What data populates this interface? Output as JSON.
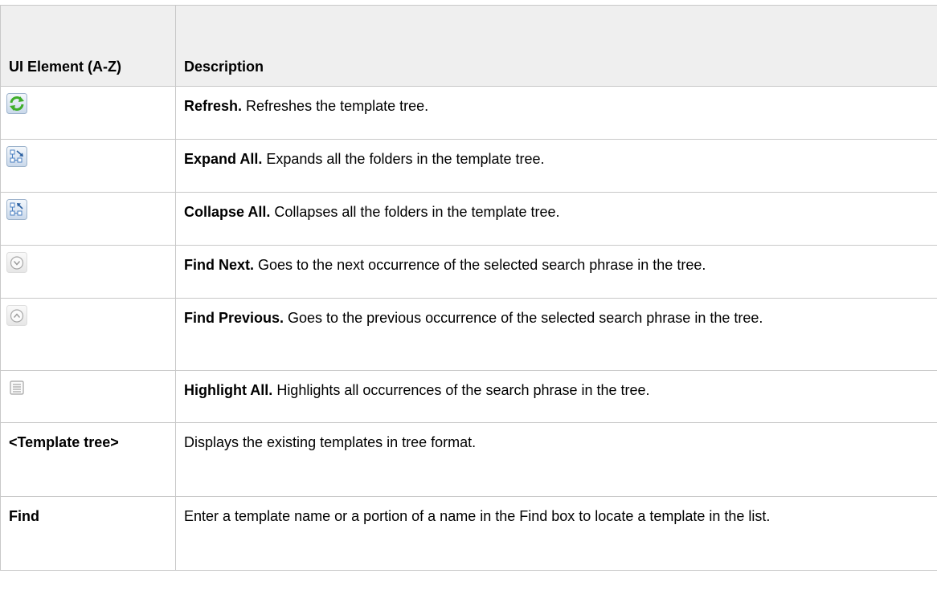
{
  "table": {
    "headers": {
      "element": "UI Element (A-Z)",
      "description": "Description"
    },
    "rows": [
      {
        "icon": "refresh-icon",
        "term": "Refresh.",
        "desc": " Refreshes the template tree."
      },
      {
        "icon": "expand-all-icon",
        "term": "Expand All.",
        "desc": " Expands all the folders in the template tree."
      },
      {
        "icon": "collapse-all-icon",
        "term": "Collapse All.",
        "desc": " Collapses all the folders in the template tree."
      },
      {
        "icon": "find-next-icon",
        "term": "Find Next.",
        "desc": " Goes to the next occurrence of the selected search phrase in the tree."
      },
      {
        "icon": "find-previous-icon",
        "term": "Find Previous.",
        "desc": " Goes to the previous occurrence of the selected search phrase in the tree."
      },
      {
        "icon": "highlight-all-icon",
        "term": "Highlight All.",
        "desc": " Highlights all occurrences of the search phrase in the tree."
      },
      {
        "name": "<Template tree>",
        "desc": "Displays the existing templates in tree format."
      },
      {
        "name": "Find",
        "desc": "Enter a template name or a portion of a name in the Find box to locate a template in the list."
      }
    ]
  },
  "colors": {
    "header_bg": "#efefef",
    "border": "#c8c8c8",
    "refresh_green": "#3fae2a",
    "icon_blue": "#4a7fc1"
  }
}
